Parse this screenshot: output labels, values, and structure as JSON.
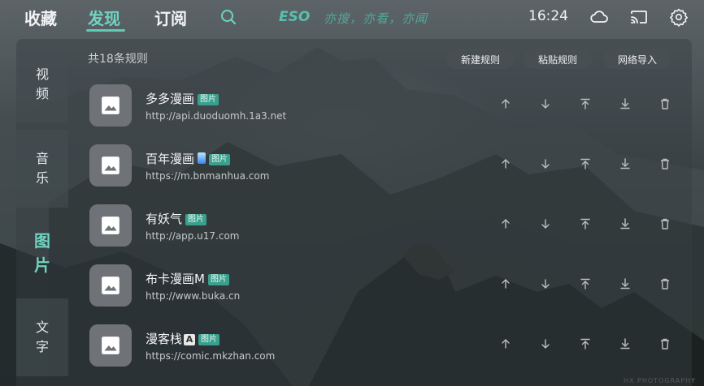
{
  "nav": {
    "tabs": [
      "收藏",
      "发现",
      "订阅"
    ],
    "brand": "ESO",
    "slogan": "亦搜，亦看，亦闻",
    "time": "16:24",
    "icons": [
      "search-icon",
      "cloud-icon",
      "cast-icon",
      "settings-icon"
    ]
  },
  "sidebar": {
    "items": [
      {
        "label": "视频"
      },
      {
        "label": "音乐"
      },
      {
        "label": "图片"
      },
      {
        "label": "文字"
      }
    ]
  },
  "toolbar": {
    "count": "共18条规则",
    "buttons": [
      "新建规则",
      "粘贴规则",
      "网络导入"
    ]
  },
  "rules": [
    {
      "name": "多多漫画",
      "url": "http://api.duoduomh.1a3.net",
      "badge": "图片"
    },
    {
      "name": "百年漫画",
      "url": "https://m.bnmanhua.com",
      "badge": "图片"
    },
    {
      "name": "有妖气",
      "url": "http://app.u17.com",
      "badge": "图片"
    },
    {
      "name": "布卡漫画M",
      "url": "http://www.buka.cn",
      "badge": "图片"
    },
    {
      "name": "漫客栈",
      "name_suffix": "A",
      "url": "https://comic.mkzhan.com",
      "badge": "图片"
    }
  ],
  "row_actions": [
    "arrow-up-icon",
    "arrow-down-icon",
    "move-to-top-icon",
    "move-to-bottom-icon",
    "delete-icon"
  ],
  "watermark": "HX PHOTOGRAPHY",
  "colors": {
    "accent": "#6fd3c1",
    "badge": "#3a9f8d"
  }
}
